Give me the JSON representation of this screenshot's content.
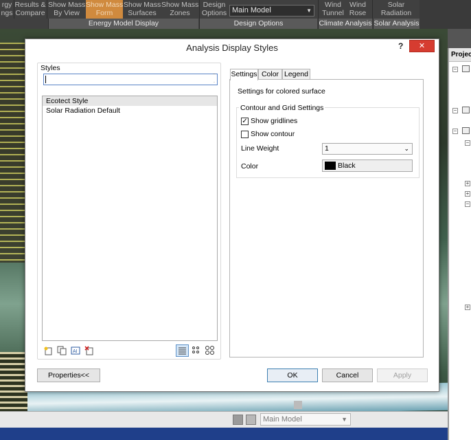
{
  "ribbon": {
    "buttons": [
      {
        "label": "rgy\nngs"
      },
      {
        "label": "Results &\nCompare"
      },
      {
        "label": "Show Mass\nBy View"
      },
      {
        "label": "Show Mass\nForm"
      },
      {
        "label": "Show Mass\nSurfaces"
      },
      {
        "label": "Show Mass\nZones"
      },
      {
        "label": "Design\nOptions"
      },
      {
        "label": "Wind\nTunnel"
      },
      {
        "label": "Wind\nRose"
      },
      {
        "label": "Solar\nRadiation"
      }
    ],
    "design_option_value": "Main Model",
    "panels": {
      "energy": "Energy Model Display",
      "design": "Design Options",
      "climate": "Climate Analysis",
      "solar": "Solar Analysis"
    }
  },
  "dialog": {
    "title": "Analysis Display Styles",
    "help": "?",
    "close": "✕",
    "styles_label": "Styles",
    "search_value": "",
    "styles": [
      "Ecotect Style",
      "Solar Radiation Default"
    ],
    "tabs": [
      "Settings",
      "Color",
      "Legend"
    ],
    "settings": {
      "description": "Settings for colored surface",
      "group_label": "Contour and Grid Settings",
      "show_gridlines_label": "Show gridlines",
      "show_gridlines_checked": true,
      "show_contour_label": "Show contour",
      "show_contour_checked": false,
      "line_weight_label": "Line Weight",
      "line_weight_value": "1",
      "color_label": "Color",
      "color_value": "Black"
    },
    "buttons": {
      "properties": "Properties<<",
      "ok": "OK",
      "cancel": "Cancel",
      "apply": "Apply"
    }
  },
  "statusbar": {
    "model_value": "Main Model"
  },
  "project_browser": {
    "title": "Project"
  },
  "icons": {
    "new_style": "new-style-icon",
    "duplicate": "duplicate-icon",
    "rename": "rename-icon",
    "delete": "delete-icon",
    "list_view": "list-view-icon",
    "small_icons": "small-icons-view-icon",
    "large_icons": "large-icons-view-icon"
  },
  "colors": {
    "ribbon_active": "#d08a3e",
    "close_button": "#d63c30",
    "color_swatch": "#000000"
  }
}
